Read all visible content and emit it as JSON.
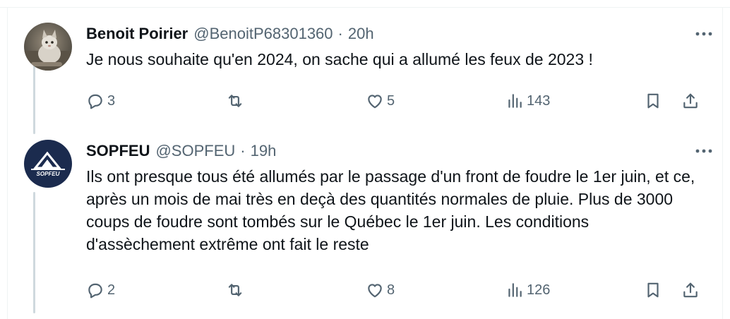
{
  "tweets": [
    {
      "name": "Benoit Poirier",
      "handle": "@BenoitP68301360",
      "separator": "·",
      "time": "20h",
      "text": "Je nous souhaite qu'en 2024, on sache qui a allumé les feux de 2023 !",
      "replies": "3",
      "retweets": "",
      "likes": "5",
      "views": "143",
      "avatar_icon": "cat-photo-avatar"
    },
    {
      "name": "SOPFEU",
      "handle": "@SOPFEU",
      "separator": "·",
      "time": "19h",
      "text": "Ils ont presque tous été allumés par le passage d'un front de foudre le 1er juin, et ce, après un mois de mai très en deçà des quantités normales de pluie. Plus de 3000 coups de foudre sont tombés sur le Québec le 1er juin. Les conditions d'assèchement extrême ont fait le reste",
      "replies": "2",
      "retweets": "",
      "likes": "8",
      "views": "126",
      "avatar_icon": "sopfeu-logo",
      "avatar_logo_text": "SOPFEU"
    }
  ],
  "colors": {
    "text": "#0f1419",
    "secondary": "#536471",
    "thread_line": "#cfd9de",
    "sopfeu_navy": "#1b2b4e"
  }
}
